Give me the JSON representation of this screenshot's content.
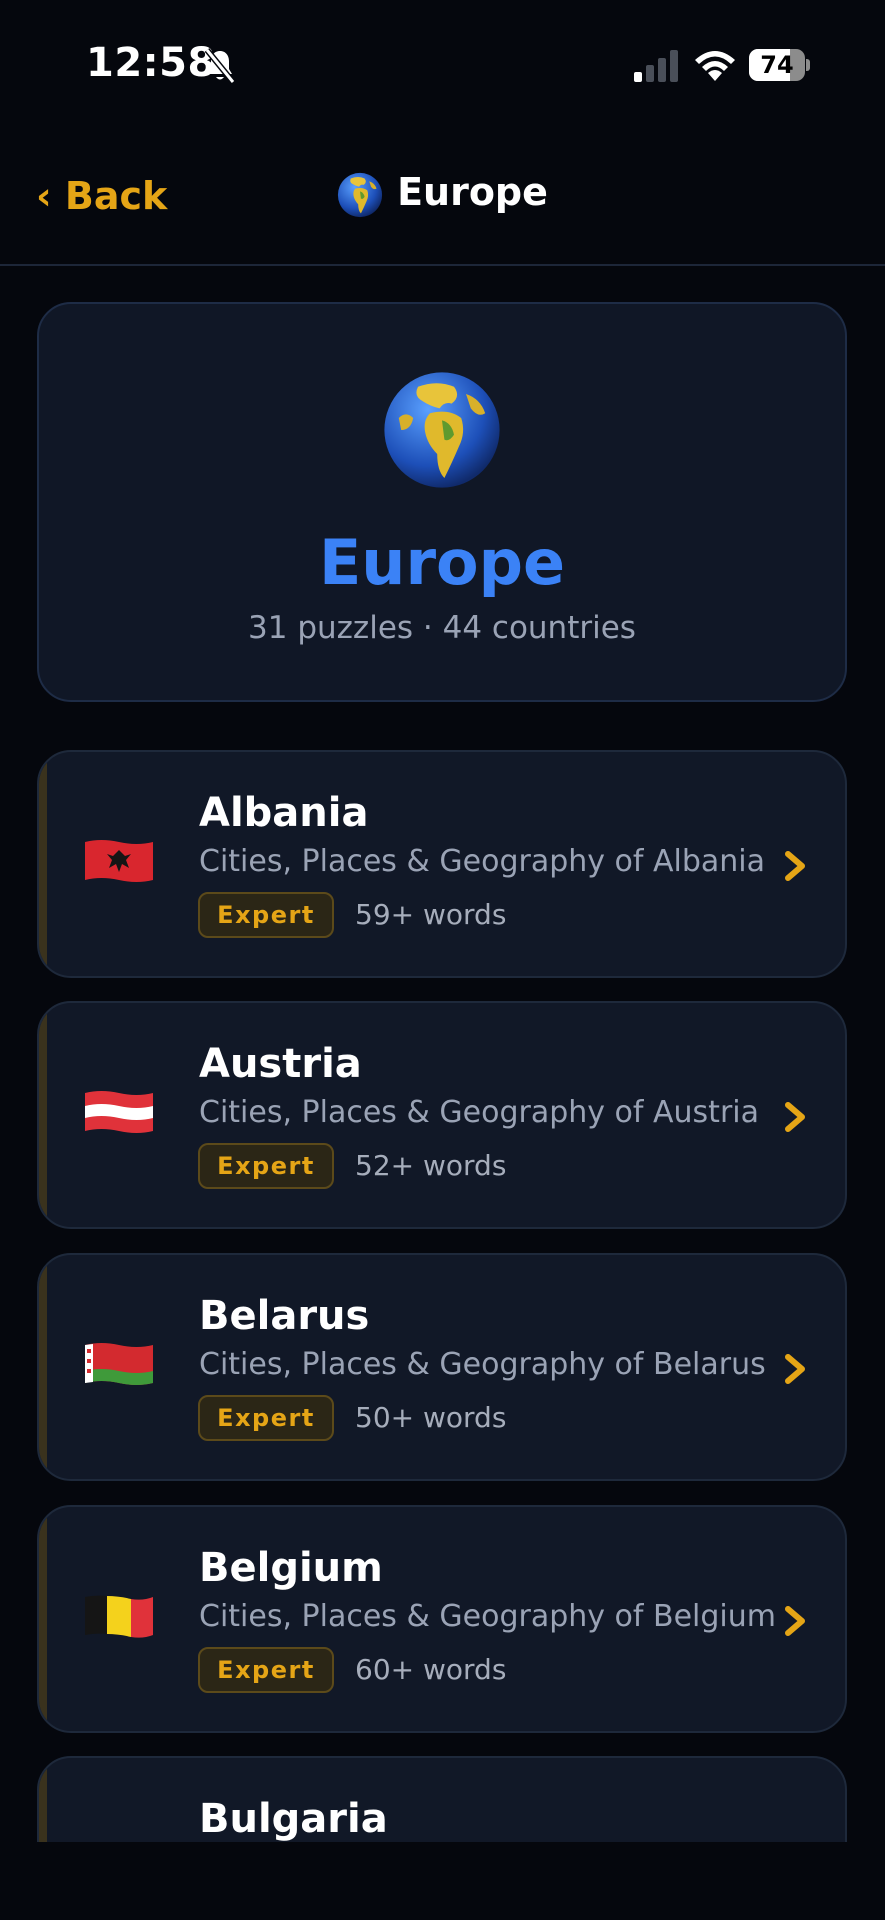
{
  "status_bar": {
    "time": "12:58",
    "battery": "74",
    "battery_level": 0.74,
    "icons": [
      "bell-slash-icon",
      "signal-icon",
      "wifi-icon",
      "battery-icon"
    ]
  },
  "nav": {
    "back_label": "‹ Back",
    "title": "Europe",
    "title_icon": "globe-emoji-icon"
  },
  "hero": {
    "title": "Europe",
    "subtitle": "31 puzzles · 44 countries",
    "icon": "globe-emoji-icon"
  },
  "colors": {
    "background": "#05070d",
    "card": "#111827",
    "accent_gold": "#e5a516",
    "hero_title_blue": "#3b82f6",
    "muted_text": "#9aa3b5"
  },
  "countries": [
    {
      "name": "Albania",
      "description": "Cities, Places & Geography of Albania",
      "difficulty": "Expert",
      "words": "59+ words",
      "flag_icon": "albania-flag-icon"
    },
    {
      "name": "Austria",
      "description": "Cities, Places & Geography of Austria",
      "difficulty": "Expert",
      "words": "52+ words",
      "flag_icon": "austria-flag-icon"
    },
    {
      "name": "Belarus",
      "description": "Cities, Places & Geography of Belarus",
      "difficulty": "Expert",
      "words": "50+ words",
      "flag_icon": "belarus-flag-icon"
    },
    {
      "name": "Belgium",
      "description": "Cities, Places & Geography of Belgium",
      "difficulty": "Expert",
      "words": "60+ words",
      "flag_icon": "belgium-flag-icon"
    },
    {
      "name": "Bulgaria",
      "description": "",
      "difficulty": "",
      "words": "",
      "flag_icon": "bulgaria-flag-icon"
    }
  ]
}
